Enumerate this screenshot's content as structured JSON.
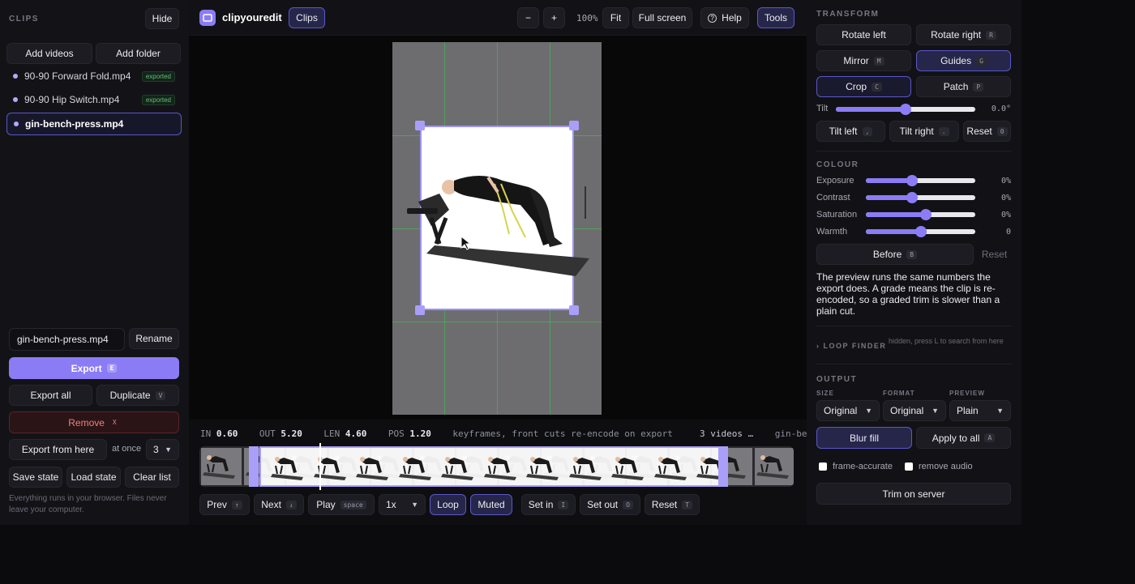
{
  "left": {
    "section_title": "CLIPS",
    "hide_label": "Hide",
    "add_videos": "Add videos",
    "add_folder": "Add folder",
    "clips": [
      {
        "name": "90-90 Forward Fold.mp4",
        "badge": "exported"
      },
      {
        "name": "90-90 Hip Switch.mp4",
        "badge": "exported"
      },
      {
        "name": "gin-bench-press.mp4",
        "badge": ""
      }
    ],
    "name_input_value": "gin-bench-press.mp4",
    "rename": "Rename",
    "export": "Export",
    "export_key": "E",
    "export_all": "Export all",
    "duplicate": "Duplicate",
    "duplicate_key": "V",
    "remove": "Remove",
    "remove_key": "X",
    "export_from_here": "Export from here",
    "at_once": "at once",
    "at_once_value": "3",
    "save_state": "Save state",
    "load_state": "Load state",
    "clear_list": "Clear list",
    "footnote": "Everything runs in your browser. Files never leave your computer."
  },
  "topbar": {
    "app_name": "clipyouredit",
    "clips_tab": "Clips",
    "zoom_out": "−",
    "zoom_in": "+",
    "zoom_level": "100%",
    "fit": "Fit",
    "full_screen": "Full screen",
    "help": "Help",
    "tools": "Tools"
  },
  "info": {
    "in_label": "IN",
    "in_value": "0.60",
    "out_label": "OUT",
    "out_value": "5.20",
    "len_label": "LEN",
    "len_value": "4.60",
    "pos_label": "POS",
    "pos_value": "1.20",
    "note": "keyframes, front cuts re-encode on export",
    "videos": "3 videos …",
    "file": "gin-bench-pr…"
  },
  "controls": {
    "prev": "Prev",
    "prev_key": "↑",
    "next": "Next",
    "next_key": "↓",
    "play": "Play",
    "play_key": "space",
    "speed": "1x",
    "loop": "Loop",
    "muted": "Muted",
    "set_in": "Set in",
    "set_in_key": "I",
    "set_out": "Set out",
    "set_out_key": "O",
    "reset": "Reset",
    "reset_key": "T"
  },
  "transform": {
    "title": "TRANSFORM",
    "rotate_left": "Rotate left",
    "rotate_right": "Rotate right",
    "rotate_right_key": "R",
    "mirror": "Mirror",
    "mirror_key": "M",
    "guides": "Guides",
    "guides_key": "G",
    "crop": "Crop",
    "crop_key": "C",
    "patch": "Patch",
    "patch_key": "P",
    "tilt_label": "Tilt",
    "tilt_value": "0.0°",
    "tilt_level": 0.5,
    "tilt_left": "Tilt left",
    "tilt_left_key": ",",
    "tilt_right": "Tilt right",
    "tilt_right_key": ".",
    "reset": "Reset",
    "reset_key": "0"
  },
  "colour": {
    "title": "COLOUR",
    "rows": [
      {
        "label": "Exposure",
        "value": "0%",
        "level": 0.42
      },
      {
        "label": "Contrast",
        "value": "0%",
        "level": 0.42
      },
      {
        "label": "Saturation",
        "value": "0%",
        "level": 0.55
      },
      {
        "label": "Warmth",
        "value": "0",
        "level": 0.5
      }
    ],
    "before": "Before",
    "before_key": "B",
    "reset": "Reset",
    "note": "The preview runs the same numbers the export does. A grade means the clip is re-encoded, so a graded trim is slower than a plain cut."
  },
  "loop_finder": {
    "title": "› LOOP FINDER",
    "hint": "hidden, press L to search from here"
  },
  "output": {
    "title": "OUTPUT",
    "size_label": "SIZE",
    "size_value": "Original",
    "format_label": "FORMAT",
    "format_value": "Original",
    "preview_label": "PREVIEW",
    "preview_value": "Plain",
    "blur_fill": "Blur fill",
    "apply_to_all": "Apply to all",
    "apply_key": "A",
    "frame_accurate": "frame-accurate",
    "remove_audio": "remove audio",
    "trim_on_server": "Trim on server"
  }
}
